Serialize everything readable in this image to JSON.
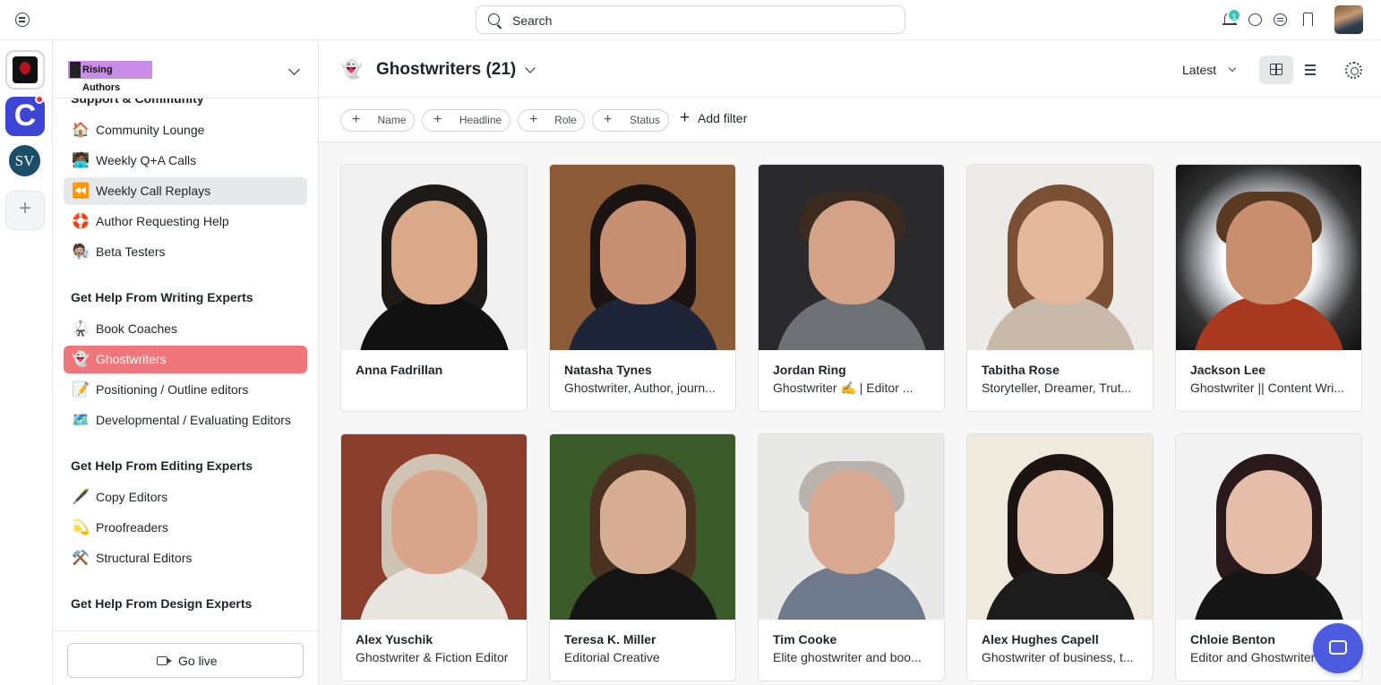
{
  "search": {
    "placeholder": "Search"
  },
  "topbar": {
    "notification_count": "1"
  },
  "sidebar": {
    "community_name": "Rising Authors",
    "sections": [
      {
        "title": "Support & Community"
      },
      {
        "title": "Get Help From Writing Experts"
      },
      {
        "title": "Get Help From Editing Experts"
      },
      {
        "title": "Get Help From Design Experts"
      }
    ],
    "items": [
      {
        "emoji": "🏠",
        "label": "Community Lounge"
      },
      {
        "emoji": "🧑🏾‍💻",
        "label": "Weekly Q+A Calls"
      },
      {
        "emoji": "⏪",
        "label": "Weekly Call Replays"
      },
      {
        "emoji": "🛟",
        "label": "Author Requesting Help"
      },
      {
        "emoji": "🧑🏽‍🔬",
        "label": "Beta Testers"
      },
      {
        "emoji": "🥋",
        "label": "Book Coaches"
      },
      {
        "emoji": "👻",
        "label": "Ghostwriters"
      },
      {
        "emoji": "📝",
        "label": "Positioning / Outline editors"
      },
      {
        "emoji": "🗺️",
        "label": "Developmental / Evaluating Editors"
      },
      {
        "emoji": "🖋️",
        "label": "Copy Editors"
      },
      {
        "emoji": "💫",
        "label": "Proofreaders"
      },
      {
        "emoji": "⚒️",
        "label": "Structural Editors"
      }
    ],
    "go_live": "Go live"
  },
  "main": {
    "space_emoji": "👻",
    "title": "Ghostwriters (21)",
    "sort_label": "Latest",
    "filters": [
      "Name",
      "Headline",
      "Role",
      "Status"
    ],
    "add_filter": "Add filter"
  },
  "members": [
    {
      "name": "Anna Fadrillan",
      "headline": ""
    },
    {
      "name": "Natasha Tynes",
      "headline": "Ghostwriter, Author, journ..."
    },
    {
      "name": "Jordan Ring",
      "headline": "Ghostwriter ✍️ | Editor ..."
    },
    {
      "name": "Tabitha Rose",
      "headline": "Storyteller, Dreamer, Trut..."
    },
    {
      "name": "Jackson Lee",
      "headline": "Ghostwriter || Content Wri..."
    },
    {
      "name": "Alex Yuschik",
      "headline": "Ghostwriter & Fiction Editor"
    },
    {
      "name": "Teresa K. Miller",
      "headline": "Editorial Creative"
    },
    {
      "name": "Tim Cooke",
      "headline": "Elite ghostwriter and boo..."
    },
    {
      "name": "Alex Hughes Capell",
      "headline": "Ghostwriter of business, t..."
    },
    {
      "name": "Chloie Benton",
      "headline": "Editor and Ghostwriter"
    }
  ],
  "colors": {
    "active_item": "#ef767a",
    "accent": "#4d5be0",
    "badge": "#3bc6b4"
  }
}
